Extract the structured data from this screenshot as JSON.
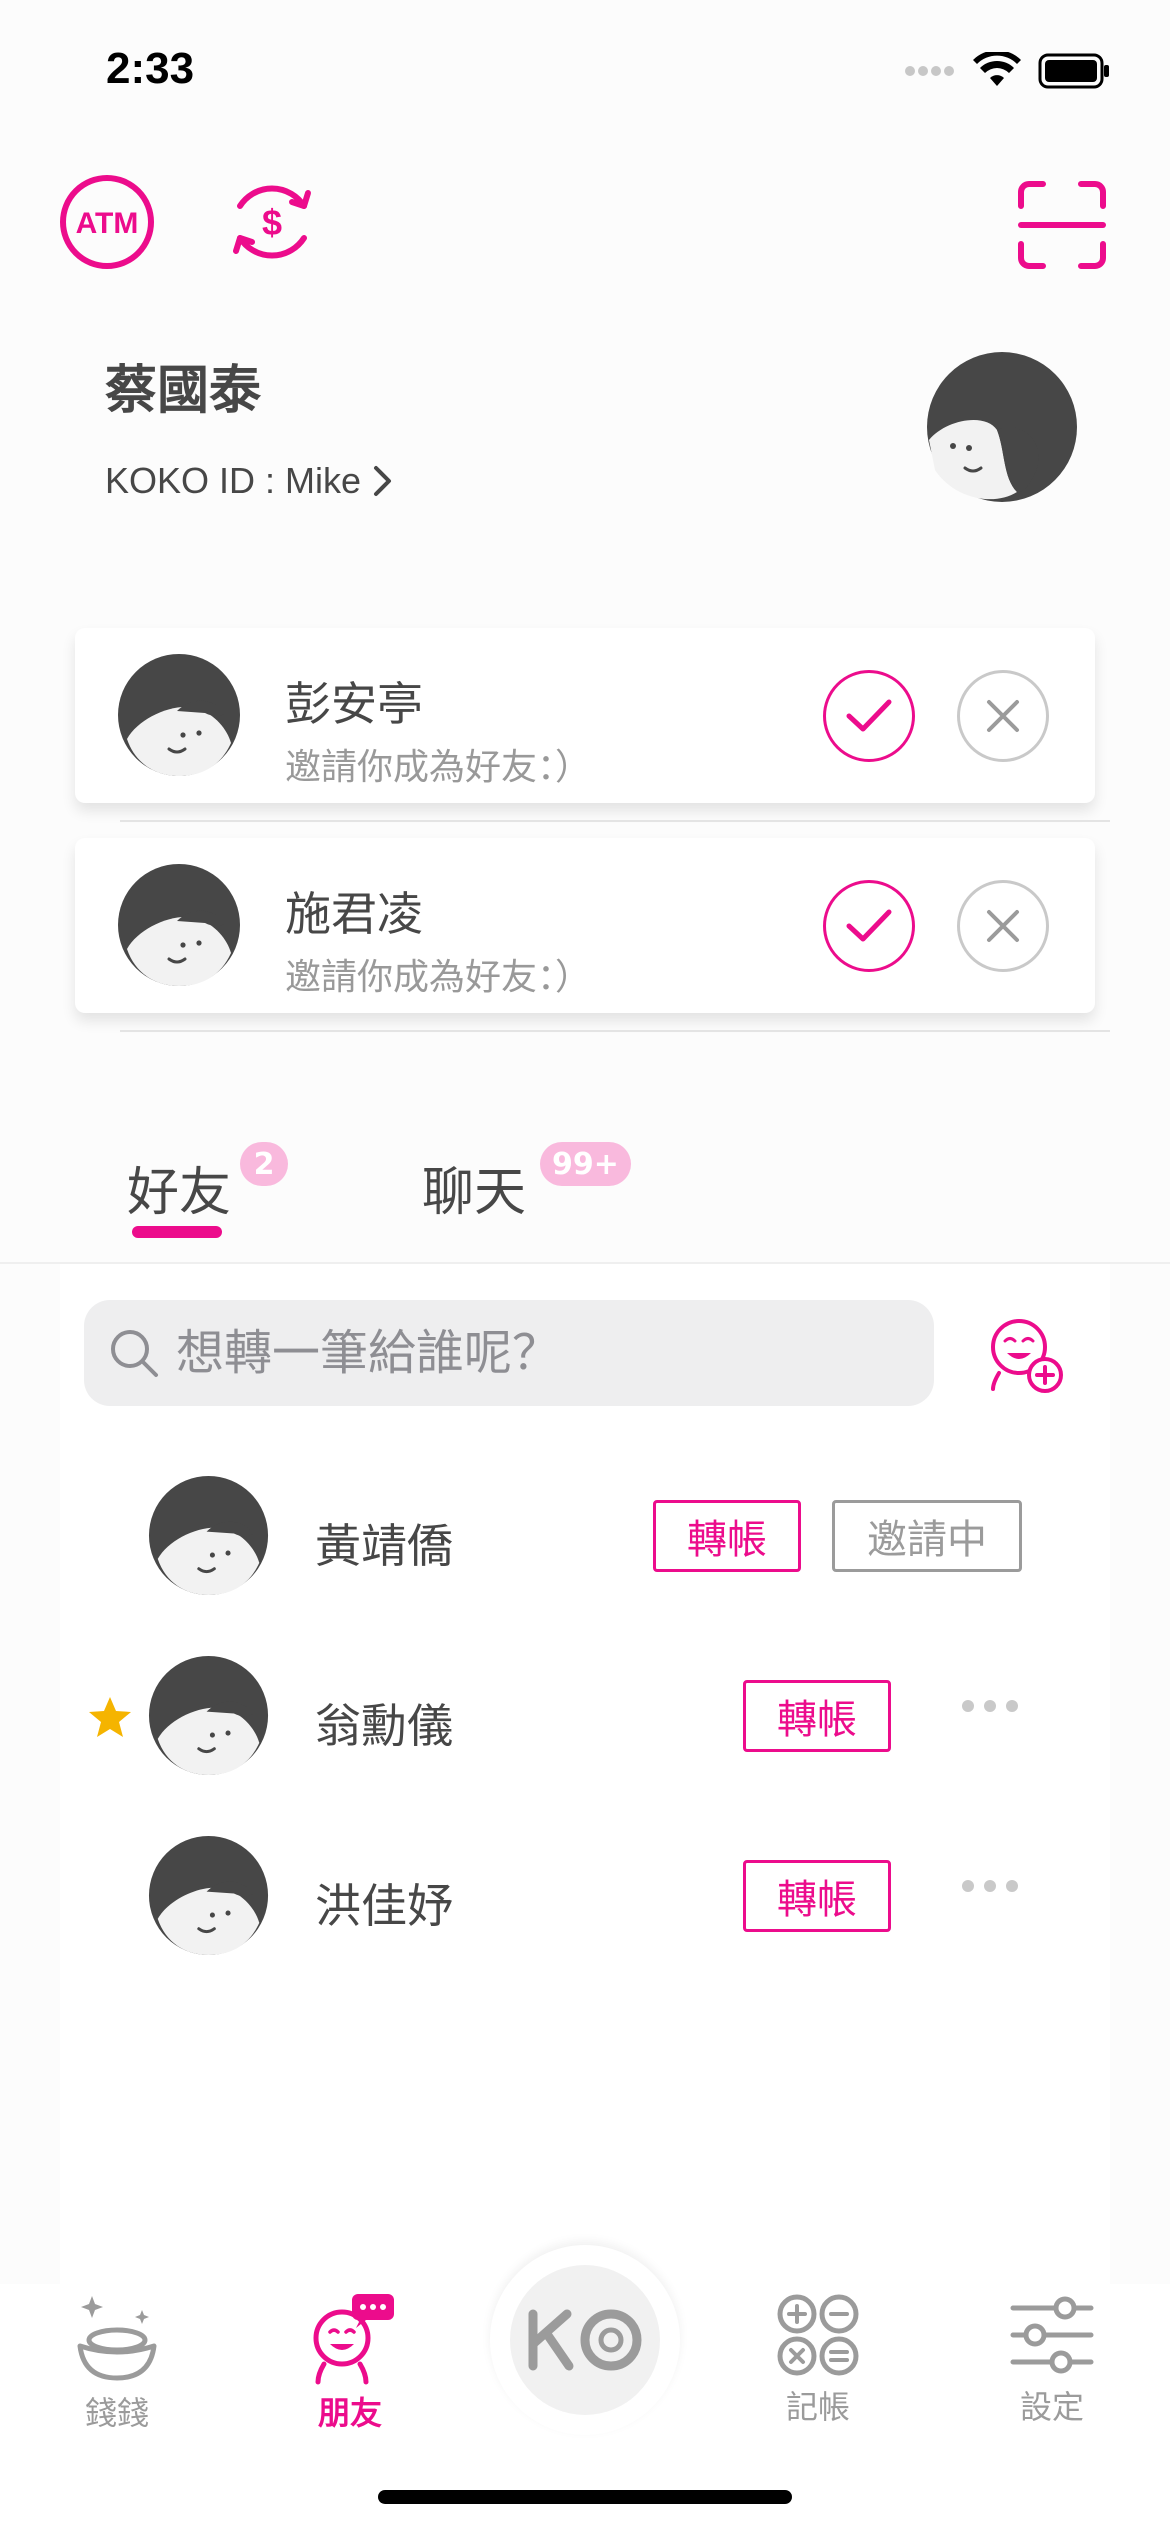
{
  "status_bar": {
    "time": "2:33"
  },
  "colors": {
    "accent": "#ec0c8c",
    "accent_light": "#f9b9dd",
    "text": "#474747",
    "muted": "#999999"
  },
  "header": {
    "atm_icon_text": "ATM",
    "profile_name": "蔡國泰",
    "koko_id": "KOKO ID : Mike"
  },
  "invitations": [
    {
      "name": "彭安亭",
      "message": "邀請你成為好友：）"
    },
    {
      "name": "施君凌",
      "message": "邀請你成為好友：）"
    }
  ],
  "tabs": [
    {
      "label": "好友",
      "badge": "2",
      "active": true
    },
    {
      "label": "聊天",
      "badge": "99+",
      "active": false
    }
  ],
  "search": {
    "placeholder": "想轉一筆給誰呢？"
  },
  "friends": [
    {
      "name": "黃靖僑",
      "starred": false,
      "transfer_label": "轉帳",
      "status_label": "邀請中"
    },
    {
      "name": "翁勳儀",
      "starred": true,
      "transfer_label": "轉帳"
    },
    {
      "name": "洪佳妤",
      "starred": false,
      "transfer_label": "轉帳"
    }
  ],
  "tabbar": [
    {
      "label": "錢錢",
      "icon": "money-icon",
      "active": false
    },
    {
      "label": "朋友",
      "icon": "friends-icon",
      "active": true
    },
    {
      "label": "KO",
      "icon": "ko-logo",
      "active": false
    },
    {
      "label": "記帳",
      "icon": "calculator-icon",
      "active": false
    },
    {
      "label": "設定",
      "icon": "settings-icon",
      "active": false
    }
  ]
}
